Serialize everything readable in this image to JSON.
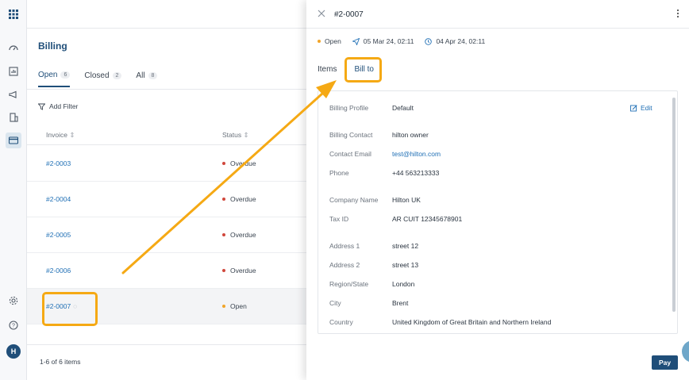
{
  "billing": {
    "title": "Billing",
    "tabs": [
      {
        "label": "Open",
        "count": "6"
      },
      {
        "label": "Closed",
        "count": "2"
      },
      {
        "label": "All",
        "count": "8"
      }
    ],
    "add_filter": "Add Filter",
    "columns": {
      "invoice": "Invoice",
      "status": "Status"
    },
    "rows": [
      {
        "invoice": "#2-0003",
        "status": "Overdue"
      },
      {
        "invoice": "#2-0004",
        "status": "Overdue"
      },
      {
        "invoice": "#2-0005",
        "status": "Overdue"
      },
      {
        "invoice": "#2-0006",
        "status": "Overdue"
      },
      {
        "invoice": "#2-0007",
        "status": "Open"
      }
    ],
    "footer": "1-6 of 6 items"
  },
  "user": {
    "initial": "H"
  },
  "drawer": {
    "title": "#2-0007",
    "status": "Open",
    "sent_date": "05 Mar 24, 02:11",
    "due_date": "04 Apr 24, 02:11",
    "tabs": [
      "Items",
      "Bill to"
    ],
    "edit": "Edit",
    "pay": "Pay",
    "fields": {
      "billing_profile": {
        "label": "Billing Profile",
        "value": "Default"
      },
      "billing_contact": {
        "label": "Billing Contact",
        "value": "hilton owner"
      },
      "contact_email": {
        "label": "Contact Email",
        "value": "test@hilton.com"
      },
      "phone": {
        "label": "Phone",
        "value": "+44 563213333"
      },
      "company_name": {
        "label": "Company Name",
        "value": "Hilton UK"
      },
      "tax_id": {
        "label": "Tax ID",
        "value": "AR CUIT 12345678901"
      },
      "address1": {
        "label": "Address 1",
        "value": "street 12"
      },
      "address2": {
        "label": "Address 2",
        "value": "street 13"
      },
      "region": {
        "label": "Region/State",
        "value": "London"
      },
      "city": {
        "label": "City",
        "value": "Brent"
      },
      "country": {
        "label": "Country",
        "value": "United Kingdom of Great Britain and Northern Ireland"
      }
    }
  },
  "colors": {
    "primary": "#1f4e79",
    "link": "#1f6fb5",
    "overdue": "#d0473c",
    "open": "#f1a52a",
    "annotation": "#f5a914"
  }
}
